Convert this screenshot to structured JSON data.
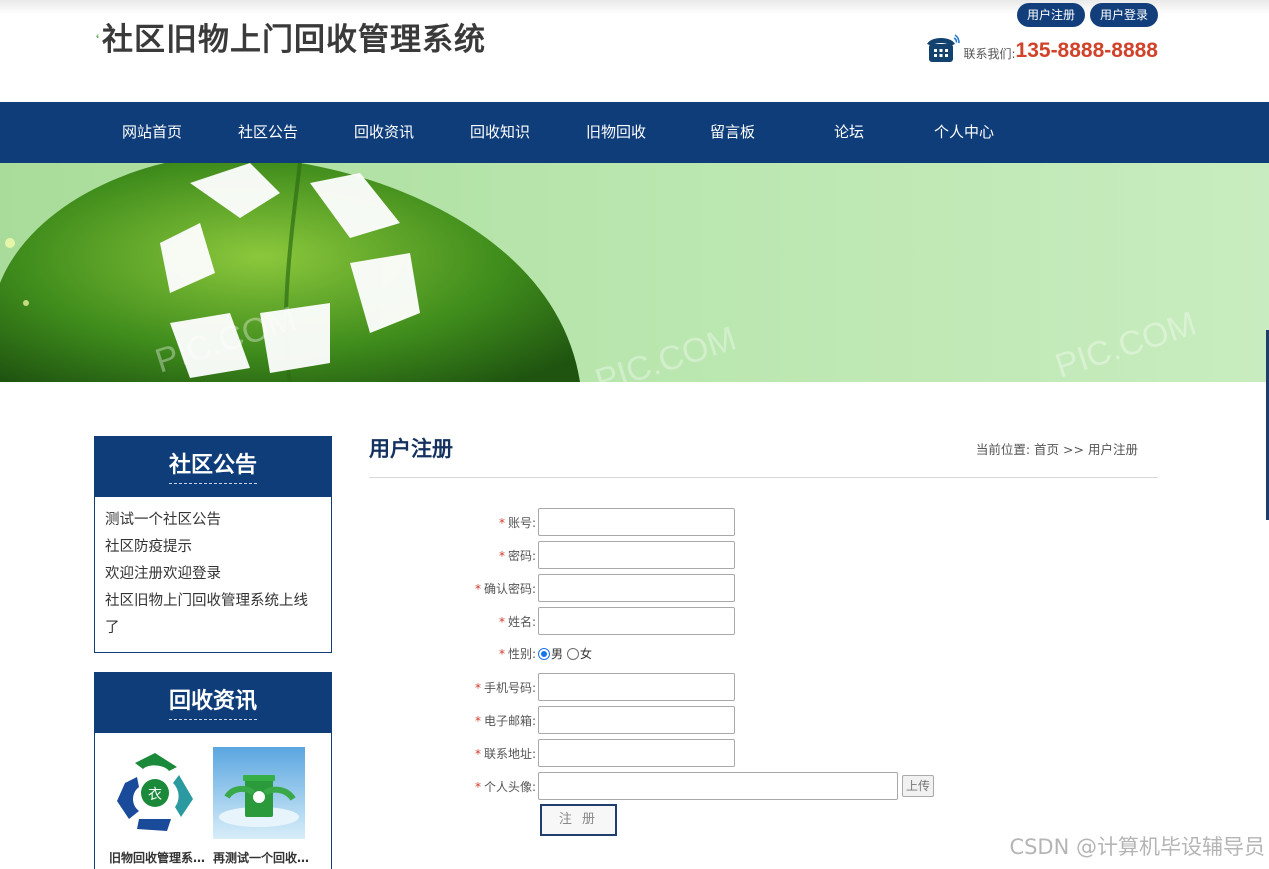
{
  "header": {
    "site_title": "社区旧物上门回收管理系统",
    "register_label": "用户注册",
    "login_label": "用户登录",
    "contact_label": "联系我们:",
    "contact_number": "135-8888-8888"
  },
  "nav": {
    "items": [
      "网站首页",
      "社区公告",
      "回收资讯",
      "回收知识",
      "旧物回收",
      "留言板",
      "论坛",
      "个人中心"
    ]
  },
  "sidebar": {
    "notices": {
      "title": "社区公告",
      "items": [
        "测试一个社区公告",
        "社区防疫提示",
        "欢迎注册欢迎登录",
        "社区旧物上门回收管理系统上线了"
      ]
    },
    "news": {
      "title": "回收资讯",
      "items": [
        {
          "caption": "旧物回收管理系统...",
          "thumb_icon": "recycle-clothes-icon"
        },
        {
          "caption": "再测试一个回收资讯",
          "thumb_icon": "recycle-bin-icon"
        }
      ]
    }
  },
  "main": {
    "title": "用户注册",
    "breadcrumb": {
      "prefix": "当前位置:",
      "home": "首页",
      "separator": ">>",
      "current": "用户注册"
    },
    "form": {
      "required_mark": "*",
      "fields": [
        {
          "label": "账号:",
          "value": ""
        },
        {
          "label": "密码:",
          "value": ""
        },
        {
          "label": "确认密码:",
          "value": ""
        },
        {
          "label": "姓名:",
          "value": ""
        }
      ],
      "gender": {
        "label": "性别:",
        "options": [
          "男",
          "女"
        ],
        "selected": "男"
      },
      "fields2": [
        {
          "label": "手机号码:",
          "value": ""
        },
        {
          "label": "电子邮箱:",
          "value": ""
        },
        {
          "label": "联系地址:",
          "value": ""
        }
      ],
      "avatar": {
        "label": "个人头像:",
        "value": "",
        "upload_label": "上传"
      },
      "submit_label": "注 册"
    }
  },
  "banner": {
    "watermarks": [
      "PIC.COM",
      "PIC.COM",
      "PIC.COM"
    ]
  },
  "watermark": "CSDN @计算机毕设辅导员",
  "colors": {
    "primary": "#0e3d7a",
    "accent_red": "#d0432a",
    "required": "#d23a2a"
  }
}
